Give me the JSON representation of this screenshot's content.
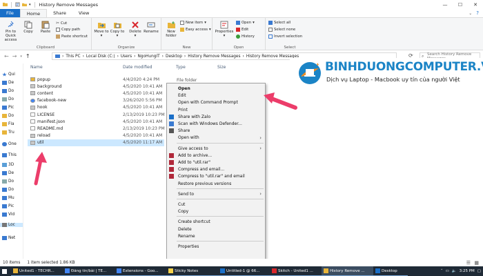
{
  "window": {
    "title": "History Remove Messages"
  },
  "tabs": [
    "File",
    "Home",
    "Share",
    "View"
  ],
  "ribbon": {
    "clipboard": {
      "label": "Clipboard",
      "pin": "Pin to Quick access",
      "copy": "Copy",
      "paste": "Paste",
      "cut": "Cut",
      "copy_path": "Copy path",
      "paste_shortcut": "Paste shortcut"
    },
    "organize": {
      "label": "Organize",
      "move_to": "Move to",
      "copy_to": "Copy to",
      "delete": "Delete",
      "rename": "Rename"
    },
    "new": {
      "label": "New",
      "new_folder": "New folder",
      "new_item": "New item",
      "easy_access": "Easy access"
    },
    "open": {
      "label": "Open",
      "properties": "Properties",
      "open": "Open",
      "edit": "Edit",
      "history": "History"
    },
    "select": {
      "label": "Select",
      "select_all": "Select all",
      "select_none": "Select none",
      "invert": "Invert selection"
    }
  },
  "address": {
    "path": [
      "This PC",
      "Local Disk (C:)",
      "Users",
      "NgoHungIT",
      "Desktop",
      "History Remove Messages",
      "History Remove Messages"
    ],
    "search_placeholder": "Search History Remove Messages"
  },
  "nav": {
    "items": [
      "Qui",
      "De",
      "Do",
      "Do",
      "Pic",
      "Do",
      "Fla",
      "Tru",
      "One",
      "This",
      "3D",
      "De",
      "Do",
      "Do",
      "Mu",
      "Pic",
      "Vid",
      "Loc",
      "Net"
    ]
  },
  "columns": {
    "name": "Name",
    "date": "Date modified",
    "type": "Type",
    "size": "Size"
  },
  "files": [
    {
      "name": "popup",
      "date": "4/4/2020 4:24 PM",
      "kind": "folder"
    },
    {
      "name": "background",
      "date": "4/5/2020 10:41 AM",
      "kind": "js"
    },
    {
      "name": "content",
      "date": "4/5/2020 10:41 AM",
      "kind": "js"
    },
    {
      "name": "facebook-new",
      "date": "3/26/2020 5:56 PM",
      "kind": "chrome"
    },
    {
      "name": "hook",
      "date": "4/5/2020 10:41 AM",
      "kind": "js"
    },
    {
      "name": "LICENSE",
      "date": "2/13/2019 10:23 PM",
      "kind": "file"
    },
    {
      "name": "manifest.json",
      "date": "4/5/2020 10:41 AM",
      "kind": "file"
    },
    {
      "name": "README.md",
      "date": "2/13/2019 10:23 PM",
      "kind": "file"
    },
    {
      "name": "reload",
      "date": "4/5/2020 10:41 AM",
      "kind": "js"
    },
    {
      "name": "util",
      "date": "4/5/2020 11:17 AM",
      "kind": "js",
      "selected": true
    }
  ],
  "first_type": "File folder",
  "context_menu": [
    {
      "label": "Open",
      "bold": true
    },
    {
      "label": "Edit"
    },
    {
      "label": "Open with Command Prompt"
    },
    {
      "label": "Print"
    },
    {
      "label": "Share with Zalo",
      "icon": "zalo"
    },
    {
      "label": "Scan with Windows Defender...",
      "icon": "defender"
    },
    {
      "label": "Share",
      "icon": "share"
    },
    {
      "label": "Open with",
      "sub": true
    },
    {
      "sep": true
    },
    {
      "label": "Give access to",
      "sub": true
    },
    {
      "label": "Add to archive...",
      "icon": "rar"
    },
    {
      "label": "Add to \"util.rar\"",
      "icon": "rar"
    },
    {
      "label": "Compress and email...",
      "icon": "rar"
    },
    {
      "label": "Compress to \"util.rar\" and email",
      "icon": "rar"
    },
    {
      "label": "Restore previous versions"
    },
    {
      "sep": true
    },
    {
      "label": "Send to",
      "sub": true
    },
    {
      "sep": true
    },
    {
      "label": "Cut"
    },
    {
      "label": "Copy"
    },
    {
      "sep": true
    },
    {
      "label": "Create shortcut"
    },
    {
      "label": "Delete"
    },
    {
      "label": "Rename"
    },
    {
      "sep": true
    },
    {
      "label": "Properties"
    }
  ],
  "status": {
    "count": "10 items",
    "selected": "1 item selected  1.86 KB"
  },
  "taskbar": [
    {
      "label": "United1 - TECHR..."
    },
    {
      "label": "Đăng tin/bài | TE..."
    },
    {
      "label": "Extensions - Goo..."
    },
    {
      "label": "Sticky Notes"
    },
    {
      "label": "Untitled-1 @ 66..."
    },
    {
      "label": "Skitch - United1 ..."
    },
    {
      "label": "History Remove ...",
      "active": true
    },
    {
      "label": "Desktop"
    }
  ],
  "clock": "3:25 PM",
  "watermark": {
    "brand": "BINHDUONGCOMPUTER.VN",
    "tagline": "Dịch vụ Laptop - Macbook uy tín của người Việt"
  },
  "colors": {
    "accent": "#1a6fc8",
    "selection": "#cce8ff",
    "arrow": "#ec3d6a",
    "brand": "#1b84c6",
    "taskbar": "#1f2a36"
  }
}
